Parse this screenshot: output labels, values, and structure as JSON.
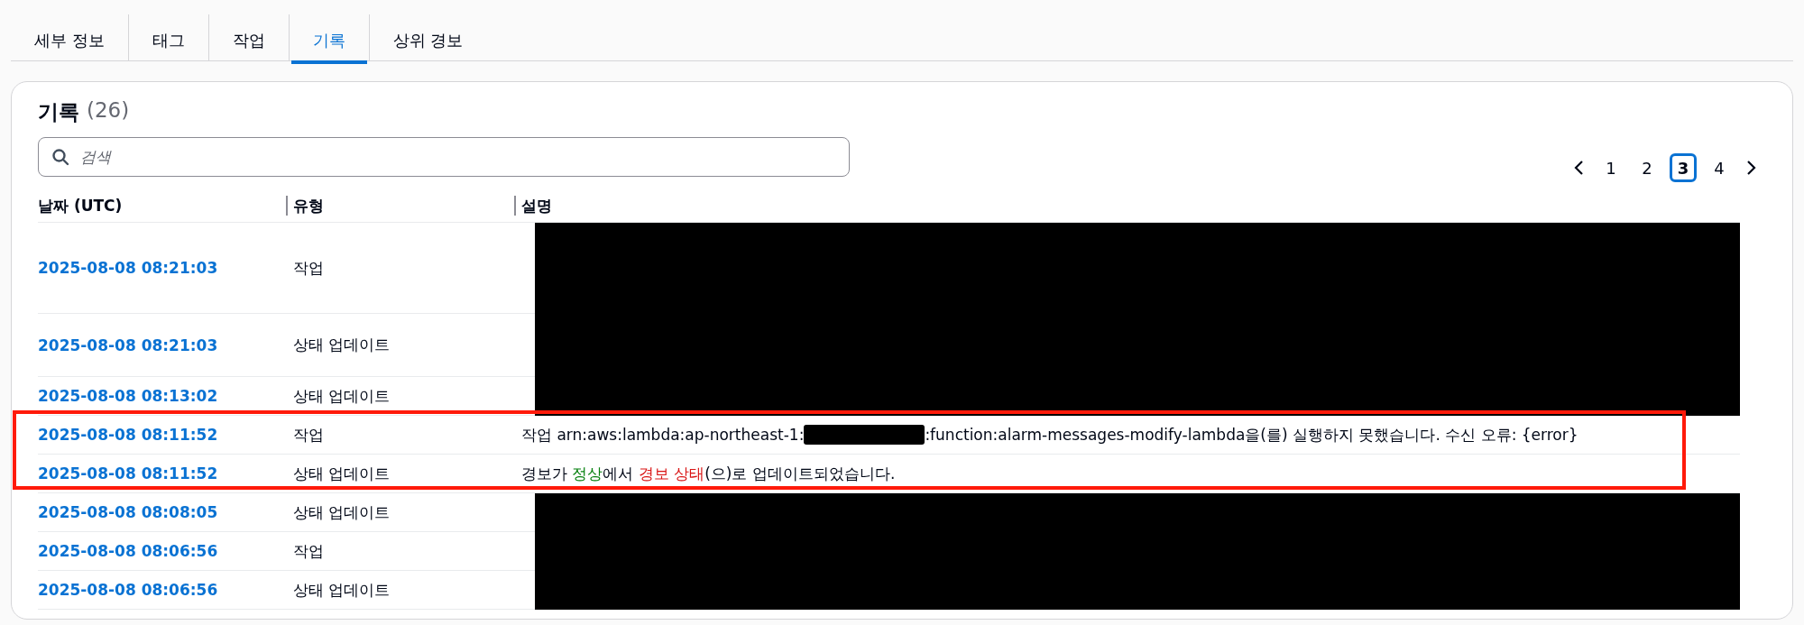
{
  "tabs": [
    {
      "label": "세부 정보",
      "selected": false
    },
    {
      "label": "태그",
      "selected": false
    },
    {
      "label": "작업",
      "selected": false
    },
    {
      "label": "기록",
      "selected": true
    },
    {
      "label": "상위 경보",
      "selected": false
    }
  ],
  "history": {
    "title": "기록",
    "count": "(26)",
    "search": {
      "placeholder": "검색"
    },
    "pagination": {
      "pages": [
        {
          "label": "1",
          "selected": false
        },
        {
          "label": "2",
          "selected": false
        },
        {
          "label": "3",
          "selected": true
        },
        {
          "label": "4",
          "selected": false
        }
      ]
    },
    "columns": [
      "날짜 (UTC)",
      "유형",
      "설명"
    ],
    "rows": [
      {
        "date": "2025-08-08 08:21:03",
        "type": "작업",
        "redacted": true,
        "highlighted": false
      },
      {
        "date": "2025-08-08 08:21:03",
        "type": "상태 업데이트",
        "redacted": true,
        "highlighted": false
      },
      {
        "date": "2025-08-08 08:13:02",
        "type": "상태 업데이트",
        "redacted": true,
        "highlighted": false
      },
      {
        "date": "2025-08-08 08:11:52",
        "type": "작업",
        "redacted": false,
        "highlighted": true,
        "description": [
          {
            "kind": "plain",
            "text": "작업 arn:aws:lambda:ap-northeast-1:"
          },
          {
            "kind": "redacted"
          },
          {
            "kind": "plain",
            "text": ":function:alarm-messages-modify-lambda을(를) 실행하지 못했습니다. 수신 오류: {error}"
          }
        ]
      },
      {
        "date": "2025-08-08 08:11:52",
        "type": "상태 업데이트",
        "redacted": false,
        "highlighted": true,
        "description": [
          {
            "kind": "sentence",
            "parts": [
              {
                "text": "경보가 "
              },
              {
                "text": "정상",
                "color": "#037f0c"
              },
              {
                "text": "에서 "
              },
              {
                "text": "경보 상태",
                "color": "#d91515"
              },
              {
                "text": "(으)로 업데이트되었습니다."
              }
            ]
          }
        ]
      },
      {
        "date": "2025-08-08 08:08:05",
        "type": "상태 업데이트",
        "redacted": true,
        "highlighted": false
      },
      {
        "date": "2025-08-08 08:06:56",
        "type": "작업",
        "redacted": true,
        "highlighted": false
      },
      {
        "date": "2025-08-08 08:06:56",
        "type": "상태 업데이트",
        "redacted": true,
        "highlighted": false
      }
    ]
  }
}
